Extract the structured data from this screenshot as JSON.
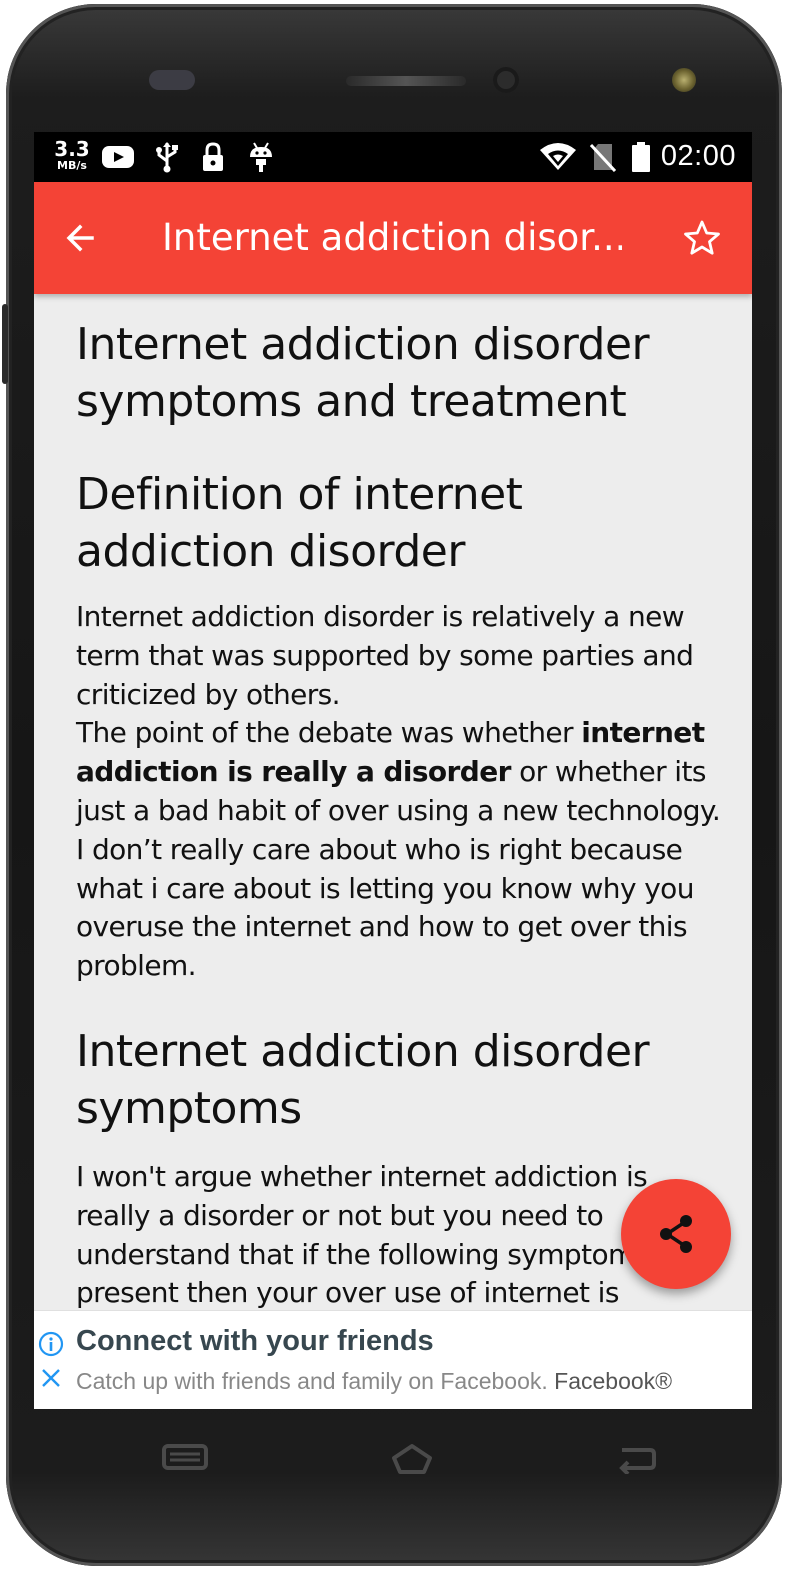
{
  "status_bar": {
    "net_speed_value": "3.3",
    "net_speed_unit": "MB/s",
    "time": "02:00",
    "left_icons": [
      "youtube-icon",
      "usb-icon",
      "lock-icon",
      "android-debug-icon"
    ],
    "right_icons": [
      "wifi-icon",
      "no-sim-icon",
      "battery-icon"
    ]
  },
  "app_bar": {
    "title": "Internet addiction disor...",
    "back_icon": "arrow-left-icon",
    "favorite_icon": "star-outline-icon",
    "color": "#f44336"
  },
  "article": {
    "title": "Internet addiction disorder symptoms and treatment",
    "definition_heading": "Definition of internet addiction disorder",
    "definition_p1": "Internet addiction disorder is relatively a new term that was supported by some parties and criticized by others.",
    "definition_p2_start": "The point of the debate was whether ",
    "definition_p2_bold": "internet addiction is really a disorder",
    "definition_p2_end": " or whether its just a bad habit of over using a new technology. I don’t really care about who is right because what i care about is letting you know why you overuse the internet and how to get over this problem.",
    "symptoms_heading": "Internet addiction disorder symptoms",
    "symptoms_p1": "I won't argue whether internet addiction is really a disorder or not but you need to understand that if the following symptoms are present then your over use of internet is"
  },
  "fab": {
    "icon": "share-icon",
    "color": "#f44336"
  },
  "ad": {
    "title": "Connect with your friends",
    "body": "Catch up with friends and family on Facebook.",
    "brand": "Facebook®",
    "info_icon": "info-icon",
    "close_icon": "close-icon"
  },
  "nav_bar": {
    "recents_icon": "recents-icon",
    "home_icon": "home-icon",
    "back_icon": "back-icon"
  }
}
